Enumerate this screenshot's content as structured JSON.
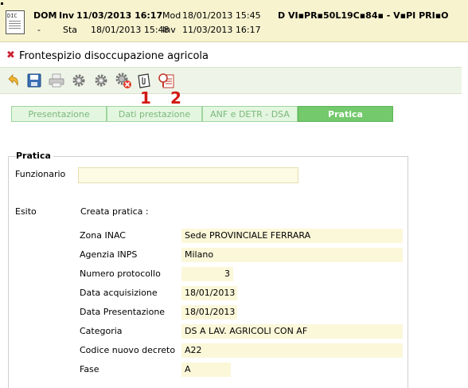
{
  "header": {
    "doc_icon_label": "DIC",
    "row1": {
      "prefix": "DOM",
      "inv_label": "Inv",
      "inv_value": "11/03/2013 16:17",
      "mod_label": "Mod",
      "mod_value": "18/01/2013 15:45",
      "person": "D VI▪PR▪50L19C▪84▪ - V▪PI PRI▪O"
    },
    "row2": {
      "prefix": "-",
      "sta_label": "Sta",
      "sta_value": "18/01/2013 15:48",
      "inv_label": "Inv",
      "inv_value": "11/03/2013 16:17"
    }
  },
  "title": "Frontespizio disoccupazione agricola",
  "toolbar": {
    "icons": [
      "undo-icon",
      "save-icon",
      "print-icon",
      "gear-icon",
      "gear-icon",
      "gear-error-icon",
      "attachment-icon",
      "search-document-icon"
    ],
    "callouts": [
      "1",
      "2"
    ]
  },
  "tabs": [
    {
      "label": "Presentazione",
      "active": false
    },
    {
      "label": "Dati prestazione",
      "active": false
    },
    {
      "label": "ANF e DETR - DSA",
      "active": false
    },
    {
      "label": "Pratica",
      "active": true
    }
  ],
  "pratica": {
    "legend": "Pratica",
    "funzionario_label": "Funzionario",
    "funzionario_value": "",
    "esito_label": "Esito",
    "esito_value": "Creata pratica :",
    "fields": [
      {
        "label": "Zona INAC",
        "value": "Sede PROVINCIALE FERRARA"
      },
      {
        "label": "Agenzia INPS",
        "value": "Milano"
      },
      {
        "label": "Numero protocollo",
        "value": "3"
      },
      {
        "label": "Data acquisizione",
        "value": "18/01/2013"
      },
      {
        "label": "Data Presentazione",
        "value": "18/01/2013"
      },
      {
        "label": "Categoria",
        "value": "DS A LAV. AGRICOLI CON AF"
      },
      {
        "label": "Codice nuovo decreto",
        "value": "A22"
      },
      {
        "label": "Fase",
        "value": "A"
      }
    ]
  },
  "colors": {
    "header_bg": "#f7f3cf",
    "tab_active": "#73c96c",
    "tab_inactive": "#e3f6df",
    "field_bg": "#fbf7d9",
    "callout": "#d21a14"
  }
}
